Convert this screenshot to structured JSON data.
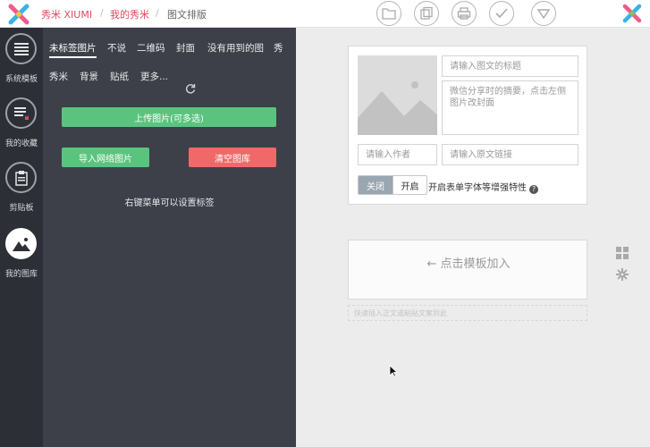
{
  "header": {
    "brand": "秀米 XIUMI",
    "crumb_mine": "我的秀米",
    "crumb_sep": "/",
    "crumb_current": "图文排版",
    "tools": [
      "folder-icon",
      "copy-icon",
      "print-icon",
      "check-icon",
      "dropdown-icon"
    ]
  },
  "rail": {
    "items": [
      {
        "label": "系统模板",
        "icon": "template-list-icon"
      },
      {
        "label": "我的收藏",
        "icon": "favorites-icon"
      },
      {
        "label": "剪贴板",
        "icon": "clipboard-icon"
      },
      {
        "label": "我的图库",
        "icon": "gallery-icon"
      }
    ]
  },
  "library": {
    "tabs_row1": [
      "未标签图片",
      "不说",
      "二维码",
      "封面",
      "没有用到的图",
      "秀"
    ],
    "tabs_row2": [
      "秀米",
      "背景",
      "贴纸",
      "更多..."
    ],
    "upload_label": "上传图片(可多选)",
    "import_label": "导入网络图片",
    "clear_label": "清空图库",
    "hint": "右键菜单可以设置标签"
  },
  "article": {
    "title_placeholder": "请输入图文的标题",
    "summary_placeholder": "微信分享时的摘要，点击左侧图片改封面",
    "author_placeholder": "请输入作者",
    "link_placeholder": "请输入原文链接",
    "toggle_off": "关闭",
    "toggle_on": "开启",
    "toggle_label": "开启表单字体等增强特性",
    "help": "?"
  },
  "editor": {
    "add_text": "← 点击模板加入",
    "paste_hint": "快速插入正文或粘贴文案到此"
  },
  "colors": {
    "brand": "#e0495f",
    "green": "#5ac47e",
    "red": "#f06868",
    "panel": "#3d4049",
    "rail": "#2c2f36"
  }
}
